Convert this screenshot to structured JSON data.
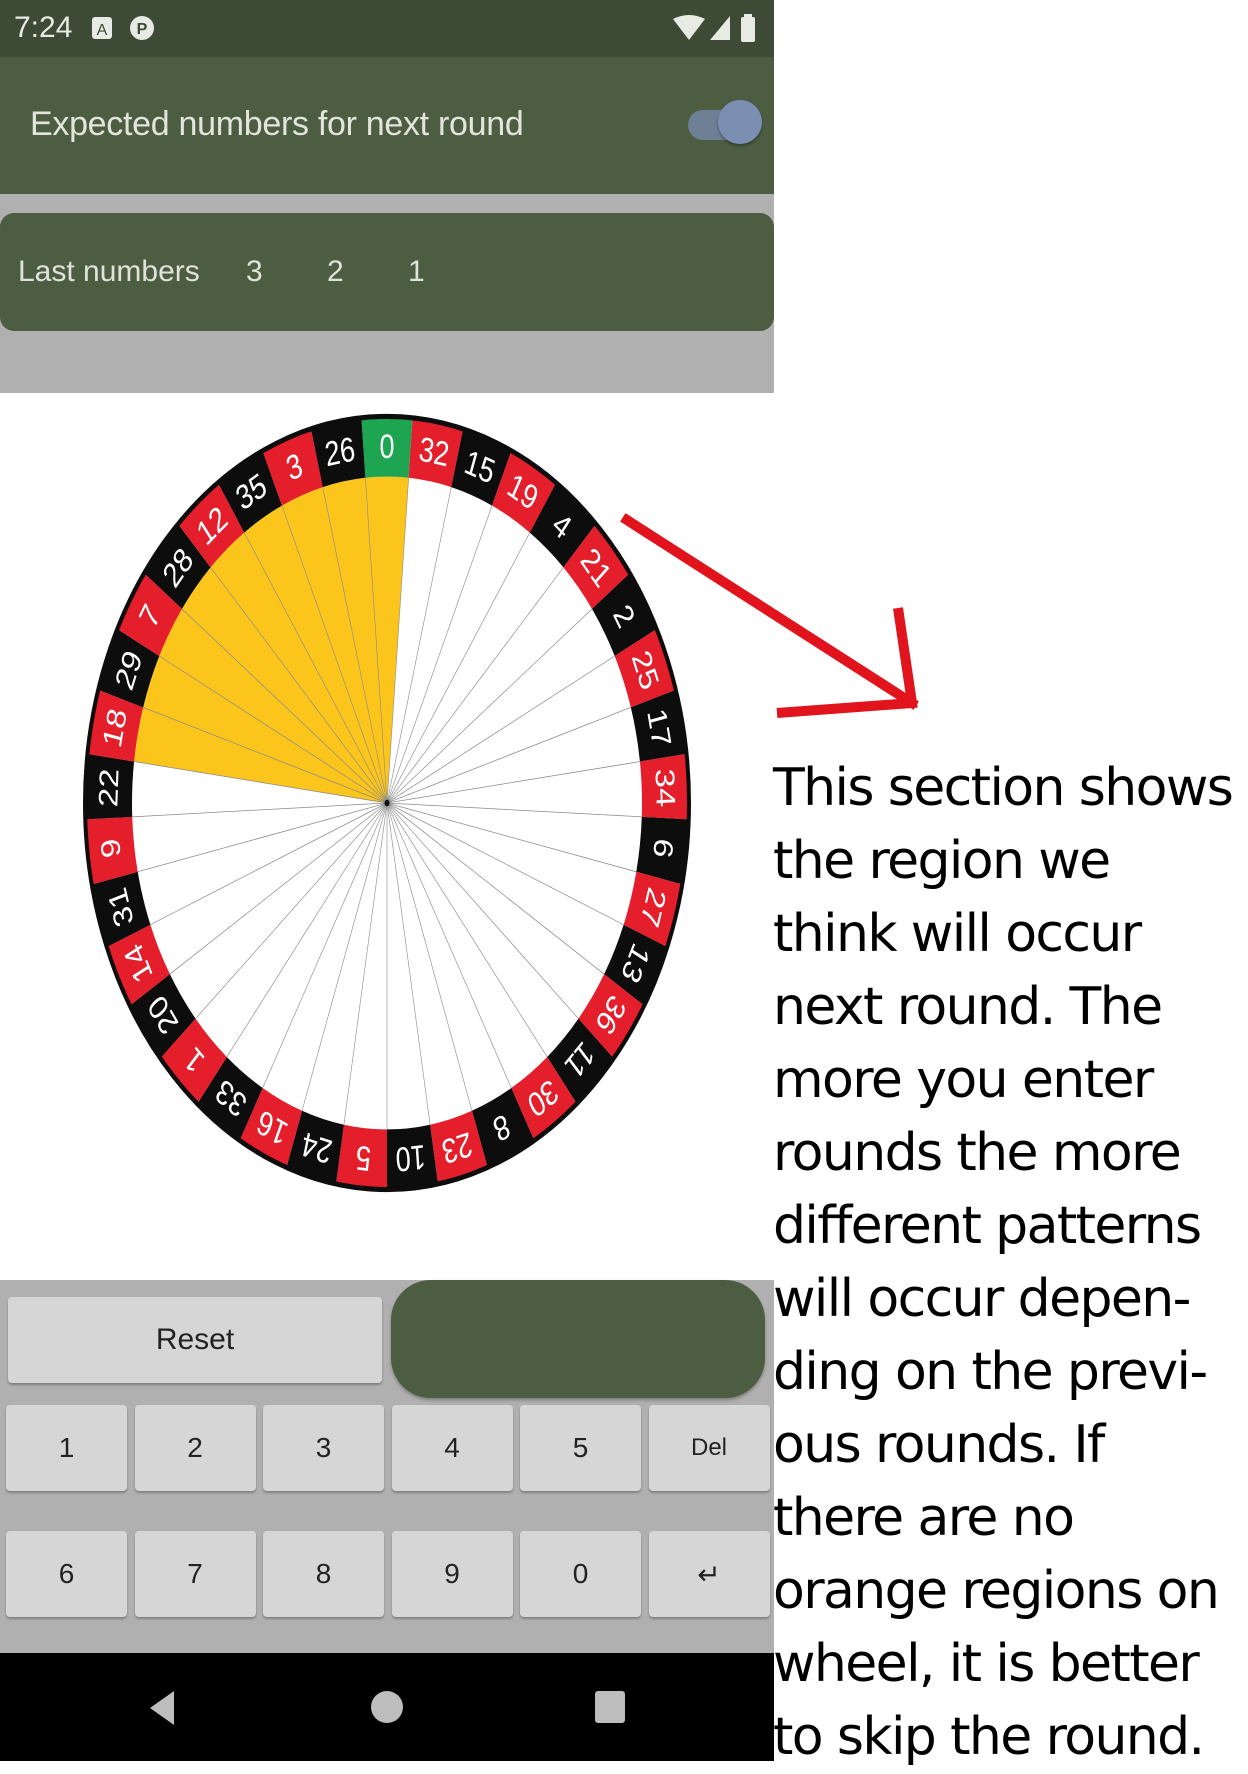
{
  "status_bar": {
    "time": "7:24"
  },
  "header": {
    "title": "Expected numbers for next round",
    "toggle_on": true
  },
  "last_numbers": {
    "label": "Last numbers",
    "values": [
      "3",
      "2",
      "1"
    ]
  },
  "wheel": {
    "sequence": [
      0,
      32,
      15,
      19,
      4,
      21,
      2,
      25,
      17,
      34,
      6,
      27,
      13,
      36,
      11,
      30,
      8,
      23,
      10,
      5,
      24,
      16,
      33,
      1,
      20,
      14,
      31,
      9,
      22,
      18,
      29,
      7,
      28,
      12,
      35,
      3,
      26
    ],
    "red_numbers": [
      32,
      19,
      21,
      25,
      34,
      27,
      36,
      30,
      23,
      5,
      16,
      1,
      14,
      9,
      18,
      7,
      12,
      3
    ],
    "highlighted_numbers": [
      0,
      18,
      29,
      7,
      28,
      12,
      35,
      3,
      26
    ],
    "colors": {
      "red": "#e41e2b",
      "black": "#0d0d0d",
      "green": "#1ea552",
      "highlight": "#fbc51c"
    }
  },
  "controls": {
    "reset_label": "Reset",
    "keys_row1": [
      "1",
      "2",
      "3",
      "4",
      "5",
      "Del"
    ],
    "keys_row2": [
      "6",
      "7",
      "8",
      "9",
      "0",
      "↵"
    ]
  },
  "annotation": {
    "lines": [
      "This section shows",
      "the region we",
      "think will occur",
      "next round. The",
      "more you enter",
      "rounds the more",
      "different patterns",
      "will occur depen-",
      "ding on the previ-",
      "ous rounds. If",
      "there are no",
      "orange regions on",
      "wheel, it is better",
      "to skip the round."
    ],
    "arrow_color": "#e1141e"
  }
}
